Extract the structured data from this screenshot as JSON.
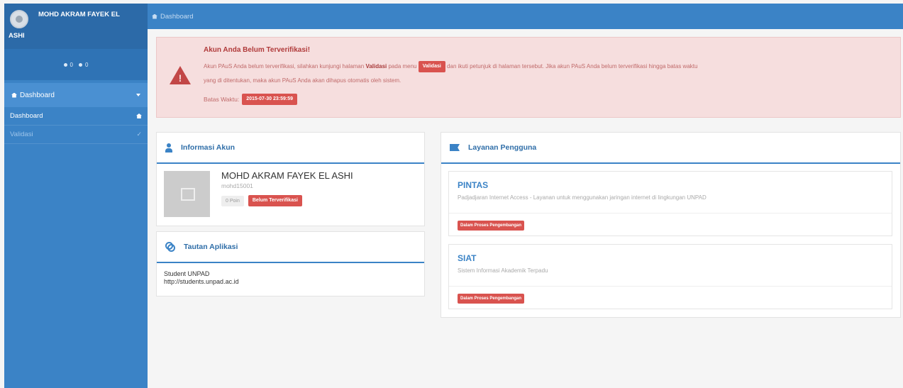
{
  "sidebar": {
    "user_name_line1": "MOHD AKRAM FAYEK EL",
    "user_name_line2": "ASHI",
    "stats": [
      "0",
      "0"
    ],
    "section_label": "Dashboard",
    "items": [
      {
        "label": "Dashboard"
      },
      {
        "label": "Validasi"
      }
    ]
  },
  "topbar": {
    "breadcrumb": "Dashboard"
  },
  "alert": {
    "title": "Akun Anda Belum Terverifikasi!",
    "text_1": "Akun PAuS Anda belum terverifikasi, silahkan kunjungi halaman",
    "text_bold": "Validasi",
    "text_2": "pada menu",
    "menu_tag": "Validasi",
    "text_3": "dan ikuti petunjuk di halaman tersebut. Jika akun PAuS Anda belum terverifikasi hingga batas waktu",
    "text_4": "yang di ditentukan, maka akun PAuS Anda akan dihapus otomatis oleh sistem.",
    "deadline_label": "Batas Waktu:",
    "deadline_value": "2015-07-30 23:59:59"
  },
  "info_panel": {
    "title": "Informasi Akun",
    "name": "MOHD AKRAM FAYEK EL ASHI",
    "username": "mohd15001",
    "points": "0 Poin",
    "status": "Belum Terverifikasi"
  },
  "link_panel": {
    "title": "Tautan Aplikasi",
    "app_name": "Student UNPAD",
    "app_url": "http://students.unpad.ac.id"
  },
  "services_panel": {
    "title": "Layanan Pengguna",
    "services": [
      {
        "name": "PINTAS",
        "description": "Padjadjaran Internet Access - Layanan untuk menggunakan jaringan internet di lingkungan UNPAD",
        "status": "Dalam Proses Pengembangan"
      },
      {
        "name": "SIAT",
        "description": "Sistem Informasi Akademik Terpadu",
        "status": "Dalam Proses Pengembangan"
      }
    ]
  },
  "colors": {
    "primary": "#3b83c6",
    "danger": "#d9534f",
    "alert_bg": "#f6dede"
  }
}
